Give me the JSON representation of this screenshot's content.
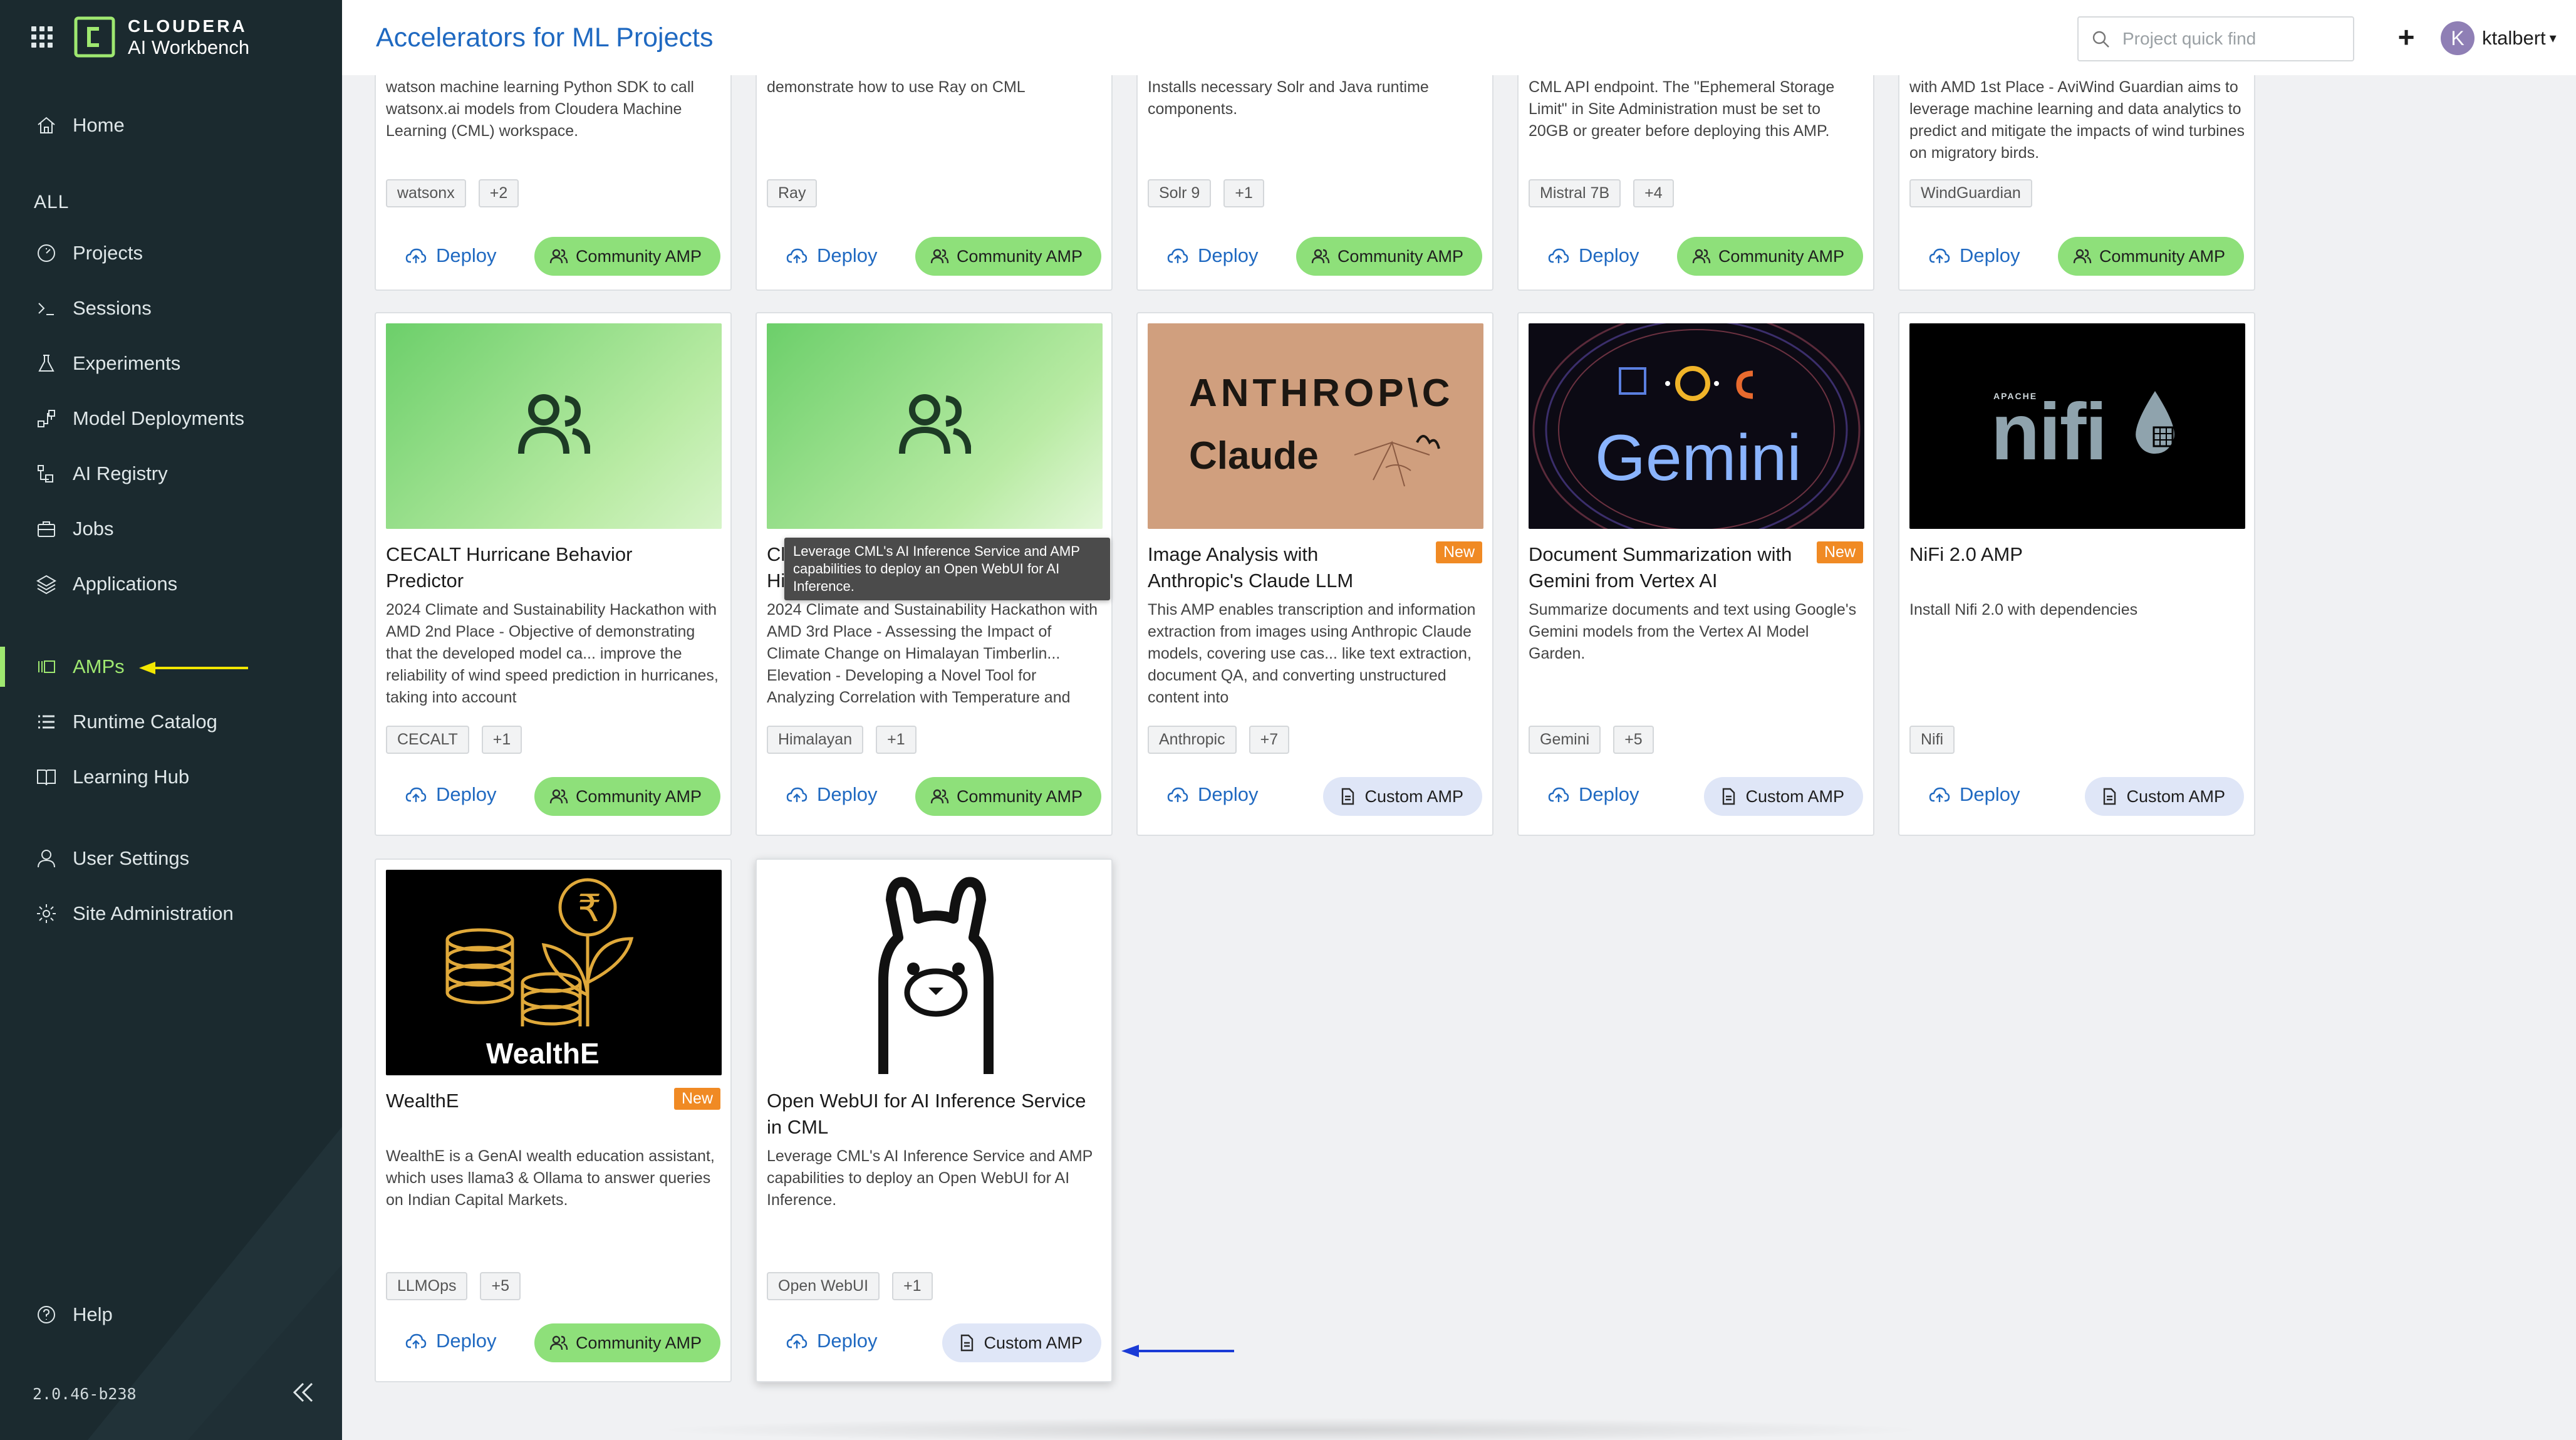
{
  "brand": {
    "line1": "CLOUDERA",
    "line2": "AI Workbench"
  },
  "nav": {
    "home": "Home",
    "section_all": "ALL",
    "projects": "Projects",
    "sessions": "Sessions",
    "experiments": "Experiments",
    "model_deployments": "Model Deployments",
    "ai_registry": "AI Registry",
    "jobs": "Jobs",
    "applications": "Applications",
    "amps": "AMPs",
    "runtime_catalog": "Runtime Catalog",
    "learning_hub": "Learning Hub",
    "user_settings": "User Settings",
    "site_administration": "Site Administration",
    "help": "Help",
    "version": "2.0.46-b238"
  },
  "header": {
    "title": "Accelerators for ML Projects",
    "search_placeholder": "Project quick find",
    "plus": "+",
    "user_initial": "K",
    "username": "ktalbert"
  },
  "labels": {
    "deploy": "Deploy",
    "community_amp": "Community AMP",
    "custom_amp": "Custom AMP",
    "new": "New"
  },
  "top_row": [
    {
      "desc": "watson machine learning Python SDK to call watsonx.ai models from Cloudera Machine Learning (CML) workspace.",
      "tags": [
        "watsonx",
        "+2"
      ],
      "type": "community"
    },
    {
      "desc": "demonstrate how to use Ray on CML",
      "tags": [
        "Ray"
      ],
      "type": "community"
    },
    {
      "desc": "Installs necessary Solr and Java runtime components.",
      "tags": [
        "Solr 9",
        "+1"
      ],
      "type": "community"
    },
    {
      "desc": "CML API endpoint. The \"Ephemeral Storage Limit\" in Site Administration must be set to 20GB or greater before deploying this AMP.",
      "tags": [
        "Mistral 7B",
        "+4"
      ],
      "type": "community"
    },
    {
      "desc": "with AMD 1st Place - AviWind Guardian aims to leverage machine learning and data analytics to predict and mitigate the impacts of wind turbines on migratory birds.",
      "tags": [
        "WindGuardian"
      ],
      "type": "community"
    }
  ],
  "middle_row": [
    {
      "title": "CECALT Hurricane Behavior Predictor",
      "desc": "2024 Climate and Sustainability Hackathon with AMD 2nd Place - Objective of demonstrating that the developed model ca... improve the reliability of wind speed prediction in hurricanes, taking into account",
      "tags": [
        "CECALT",
        "+1"
      ],
      "type": "community"
    },
    {
      "title": "Cl",
      "title2": "Hi",
      "desc": "2024 Climate and Sustainability Hackathon with AMD 3rd Place - Assessing the Impact of Climate Change on Himalayan Timberlin... Elevation - Developing a Novel Tool for Analyzing Correlation with Temperature and",
      "tags": [
        "Himalayan",
        "+1"
      ],
      "type": "community"
    },
    {
      "title": "Image Analysis with Anthropic's Claude LLM",
      "desc": "This AMP enables transcription and information extraction from images using Anthropic Claude models, covering use cas... like text extraction, document QA, and converting unstructured content into",
      "tags": [
        "Anthropic",
        "+7"
      ],
      "type": "custom",
      "is_new": true,
      "thumb_text1": "ANTHROP\\C",
      "thumb_text2": "Claude"
    },
    {
      "title": "Document Summarization with Gemini from Vertex AI",
      "desc": "Summarize documents and text using Google's Gemini models from the Vertex AI Model Garden.",
      "tags": [
        "Gemini",
        "+5"
      ],
      "type": "custom",
      "is_new": true,
      "thumb_text": "Gemini"
    },
    {
      "title": "NiFi 2.0 AMP",
      "desc": "Install Nifi 2.0 with dependencies",
      "tags": [
        "Nifi"
      ],
      "type": "custom",
      "thumb_small": "APACHE",
      "thumb_text": "nifi"
    }
  ],
  "bottom_row": [
    {
      "title": "WealthE",
      "desc": "WealthE is a GenAI wealth education assistant, which uses llama3 & Ollama to answer queries on Indian Capital Markets.",
      "tags": [
        "LLMOps",
        "+5"
      ],
      "type": "community",
      "is_new": true,
      "thumb_text": "WealthE",
      "currency": "₹"
    },
    {
      "title": "Open WebUI for AI Inference Service in CML",
      "desc": "Leverage CML's AI Inference Service and AMP capabilities to deploy an Open WebUI for AI Inference.",
      "tags": [
        "Open WebUI",
        "+1"
      ],
      "type": "custom"
    }
  ],
  "tooltip": "Leverage CML's AI Inference Service and AMP capabilities to deploy an Open WebUI for AI Inference.",
  "colors": {
    "sidebar": "#1b2a2f",
    "accent_green": "#9fe870",
    "link_blue": "#1f69c1",
    "community_pill": "#8ee07a",
    "custom_pill": "#dfe6f7",
    "new_badge": "#f08a24",
    "arrow_yellow": "#f2e600",
    "arrow_blue": "#1a3bd6"
  }
}
